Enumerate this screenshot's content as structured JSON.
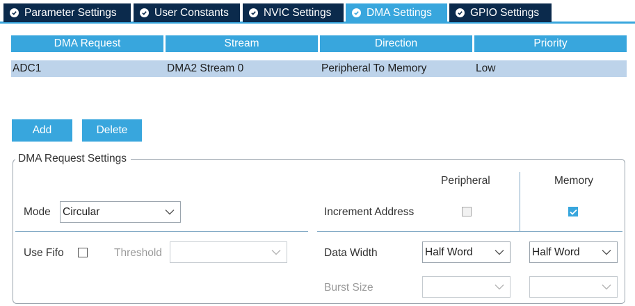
{
  "tabs": [
    {
      "label": "Parameter Settings",
      "icon": "check-circle-icon",
      "active": false
    },
    {
      "label": "User Constants",
      "icon": "check-circle-icon",
      "active": false
    },
    {
      "label": "NVIC Settings",
      "icon": "check-circle-icon",
      "active": false
    },
    {
      "label": "DMA Settings",
      "icon": "check-circle-icon",
      "active": true
    },
    {
      "label": "GPIO Settings",
      "icon": "check-circle-icon",
      "active": false
    }
  ],
  "table": {
    "headers": [
      "DMA Request",
      "Stream",
      "Direction",
      "Priority"
    ],
    "rows": [
      [
        "ADC1",
        "DMA2 Stream 0",
        "Peripheral To Memory",
        "Low"
      ]
    ]
  },
  "buttons": {
    "add": "Add",
    "delete": "Delete"
  },
  "settings": {
    "legend": "DMA Request Settings",
    "peripheral_header": "Peripheral",
    "memory_header": "Memory",
    "mode_label": "Mode",
    "mode_value": "Circular",
    "increment_label": "Increment Address",
    "increment_peripheral": false,
    "increment_memory": true,
    "use_fifo_label": "Use Fifo",
    "use_fifo": false,
    "threshold_label": "Threshold",
    "threshold_value": "",
    "data_width_label": "Data Width",
    "data_width_peripheral": "Half Word",
    "data_width_memory": "Half Word",
    "burst_label": "Burst Size",
    "burst_peripheral": "",
    "burst_memory": ""
  },
  "colors": {
    "accent": "#38a6dd",
    "tab_dark": "#0b2a4c",
    "row_selected": "#bdd3ea"
  }
}
